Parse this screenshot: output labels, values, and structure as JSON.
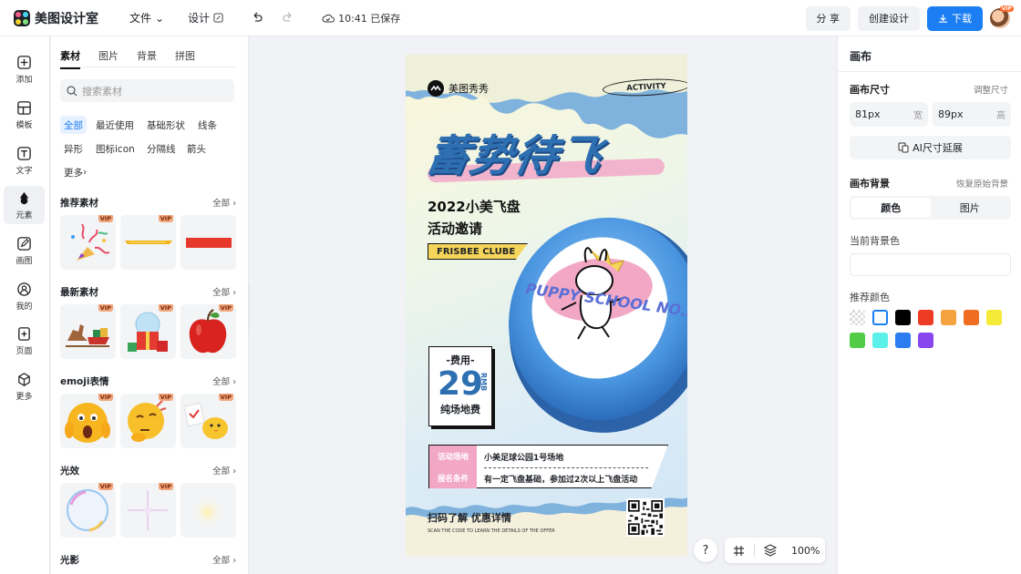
{
  "app": {
    "title": "美图设计室"
  },
  "topbar": {
    "file_menu": "文件",
    "design_menu": "设计",
    "save_status": "10:41 已保存",
    "share_label": "分 享",
    "create_label": "创建设计",
    "download_label": "下载",
    "vip_badge": "VIP"
  },
  "rail": [
    {
      "label": "添加",
      "icon": "plus-square-icon"
    },
    {
      "label": "模板",
      "icon": "layout-icon"
    },
    {
      "label": "文字",
      "icon": "text-icon"
    },
    {
      "label": "元素",
      "icon": "shapes-icon"
    },
    {
      "label": "画图",
      "icon": "pencil-icon"
    },
    {
      "label": "我的",
      "icon": "user-icon"
    },
    {
      "label": "页面",
      "icon": "add-page-icon"
    },
    {
      "label": "更多",
      "icon": "cube-icon"
    }
  ],
  "panel": {
    "tabs": [
      "素材",
      "图片",
      "背景",
      "拼图"
    ],
    "search_placeholder": "搜索素材",
    "chips": [
      "全部",
      "最近使用",
      "基础形状",
      "线条",
      "异形",
      "图标icon",
      "分隔线",
      "箭头",
      "更多"
    ],
    "sections": [
      {
        "title": "推荐素材",
        "all": "全部"
      },
      {
        "title": "最新素材",
        "all": "全部"
      },
      {
        "title": "emoji表情",
        "all": "全部"
      },
      {
        "title": "光效",
        "all": "全部"
      },
      {
        "title": "光影",
        "all": "全部"
      }
    ],
    "vip": "VIP"
  },
  "poster": {
    "brand": "美图秀秀",
    "badge": "ACTIVITY",
    "headline": "蓄势待飞",
    "subtitle_line1": "2022小美飞盘",
    "subtitle_line2": "活动邀请",
    "ribbon": "FRISBEE CLUBE",
    "fee_label": "-费用-",
    "price": "29",
    "currency": "RMB",
    "price_note": "纯场地费",
    "info_label1": "活动场地",
    "info_label2": "报名条件",
    "info_value1": "小美足球公园1号场地",
    "info_value2": "有一定飞盘基础，参加过2次以上飞盘活动",
    "scan_text": "扫码了解 优惠详情",
    "scan_en": "SCAN THE CODE TO LEARN THE DETAILS OF THE OFFER",
    "disc_text": "PUPPY SCHOOL NO.ZM!"
  },
  "zoom": {
    "level": "100%",
    "help": "?"
  },
  "right_panel": {
    "title": "画布",
    "size_label": "画布尺寸",
    "size_link": "调整尺寸",
    "width_value": "81px",
    "width_unit": "宽",
    "height_value": "89px",
    "height_unit": "高",
    "ai_label": "AI尺寸延展",
    "bg_label": "画布背景",
    "bg_link": "恢复原始背景",
    "seg_color": "颜色",
    "seg_image": "图片",
    "current_bg_label": "当前背景色",
    "recommend_label": "推荐颜色",
    "swatches": [
      "transparent",
      "#ffffff",
      "#000000",
      "#ee3b24",
      "#f5a340",
      "#ee6d21",
      "#f5ea38",
      "#52cc47",
      "#5cf0ea",
      "#2c7ef0",
      "#8847ee"
    ]
  }
}
